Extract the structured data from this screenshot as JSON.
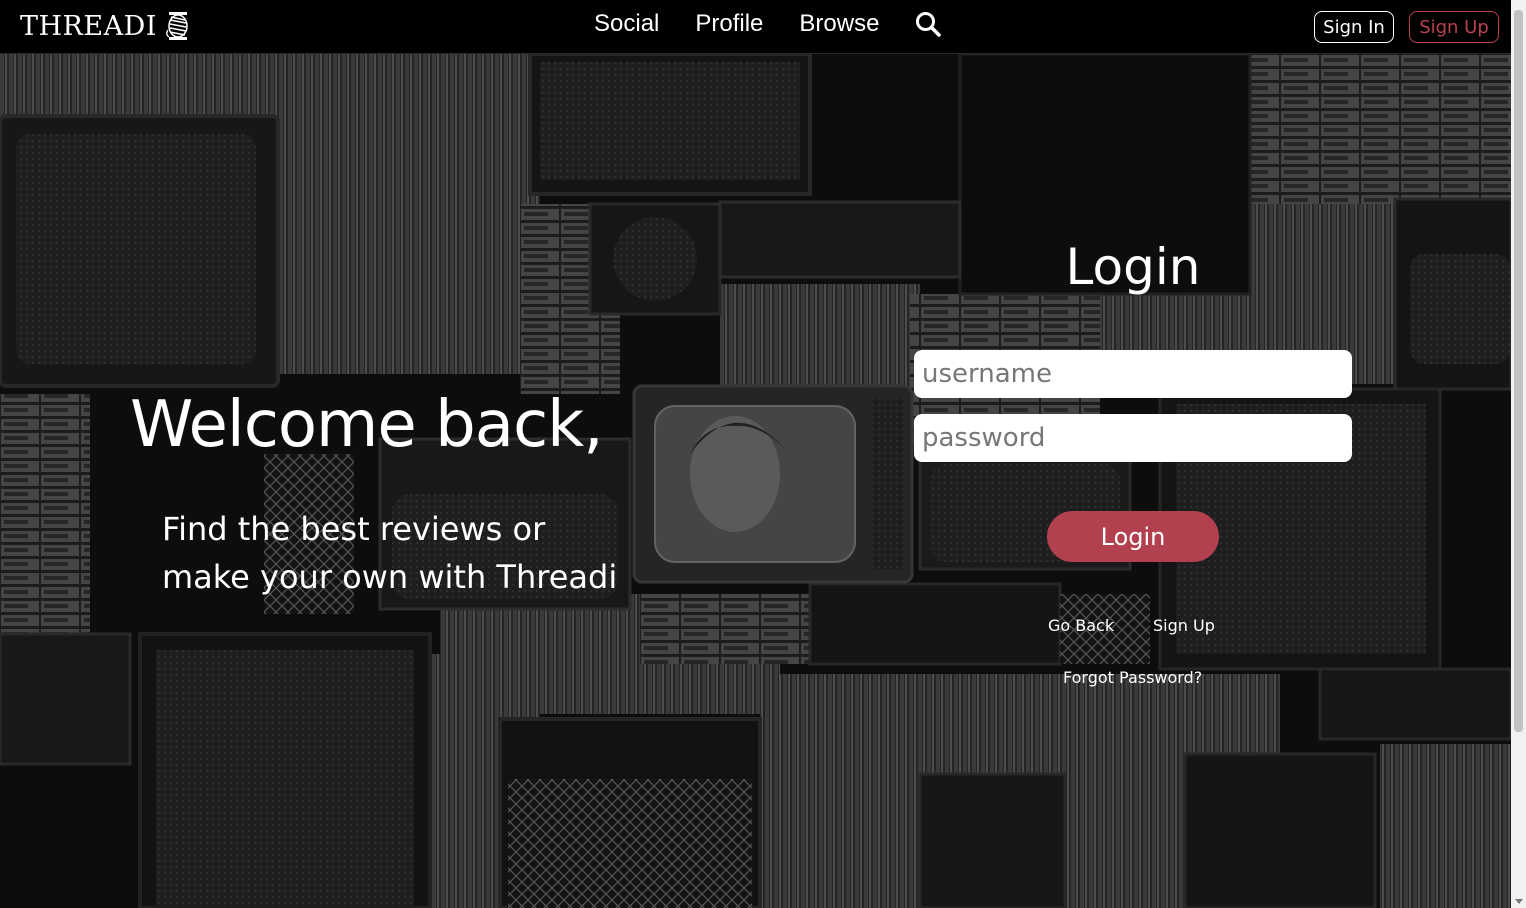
{
  "header": {
    "brand": "THREADI",
    "nav": [
      "Social",
      "Profile",
      "Browse"
    ],
    "signin_label": "Sign In",
    "signup_label": "Sign Up"
  },
  "hero": {
    "welcome": "Welcome back,",
    "tagline": "Find the best reviews or make your own with Threadi"
  },
  "login": {
    "title": "Login",
    "username_placeholder": "username",
    "password_placeholder": "password",
    "button_label": "Login",
    "go_back": "Go Back",
    "sign_up": "Sign Up",
    "forgot": "Forgot Password?"
  },
  "colors": {
    "accent": "#b2404f",
    "navbar_bg": "#000000"
  },
  "icons": [
    "thread-spool-icon",
    "search-icon"
  ]
}
